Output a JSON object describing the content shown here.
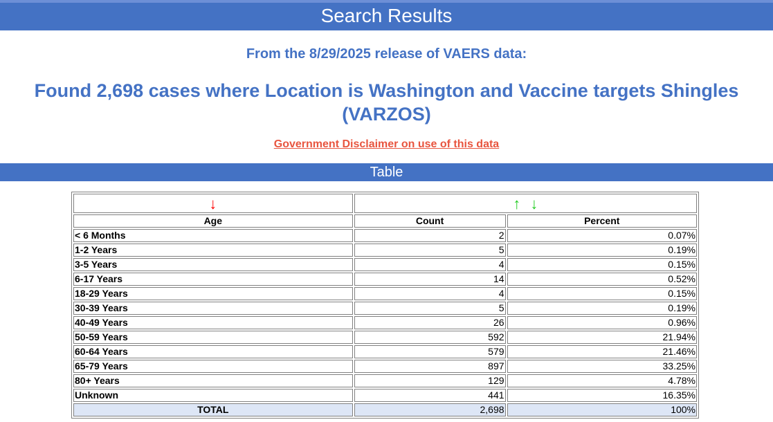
{
  "header": {
    "title": "Search Results"
  },
  "release_line": "From the 8/29/2025 release of VAERS data:",
  "found_line": "Found 2,698 cases where Location is Washington and Vaccine targets Shingles (VARZOS)",
  "disclaimer_link": "Government Disclaimer on use of this data",
  "table_banner": "Table",
  "table": {
    "sort_arrows": {
      "age_sort": "↓",
      "count_sort_up": "↑",
      "count_sort_down": "↓"
    },
    "headers": {
      "age": "Age",
      "count": "Count",
      "percent": "Percent"
    },
    "rows": [
      {
        "age": "< 6 Months",
        "count": "2",
        "percent": "0.07%"
      },
      {
        "age": "1-2 Years",
        "count": "5",
        "percent": "0.19%"
      },
      {
        "age": "3-5 Years",
        "count": "4",
        "percent": "0.15%"
      },
      {
        "age": "6-17 Years",
        "count": "14",
        "percent": "0.52%"
      },
      {
        "age": "18-29 Years",
        "count": "4",
        "percent": "0.15%"
      },
      {
        "age": "30-39 Years",
        "count": "5",
        "percent": "0.19%"
      },
      {
        "age": "40-49 Years",
        "count": "26",
        "percent": "0.96%"
      },
      {
        "age": "50-59 Years",
        "count": "592",
        "percent": "21.94%"
      },
      {
        "age": "60-64 Years",
        "count": "579",
        "percent": "21.46%"
      },
      {
        "age": "65-79 Years",
        "count": "897",
        "percent": "33.25%"
      },
      {
        "age": "80+ Years",
        "count": "129",
        "percent": "4.78%"
      },
      {
        "age": "Unknown",
        "count": "441",
        "percent": "16.35%"
      }
    ],
    "total": {
      "label": "TOTAL",
      "count": "2,698",
      "percent": "100%"
    }
  },
  "colors": {
    "banner": "#4472c4",
    "heading_text": "#4472c4",
    "disclaimer_link": "#e8553f",
    "arrow_red": "#ff0000",
    "arrow_green": "#22cc22",
    "total_row_bg": "#dde6f6"
  }
}
